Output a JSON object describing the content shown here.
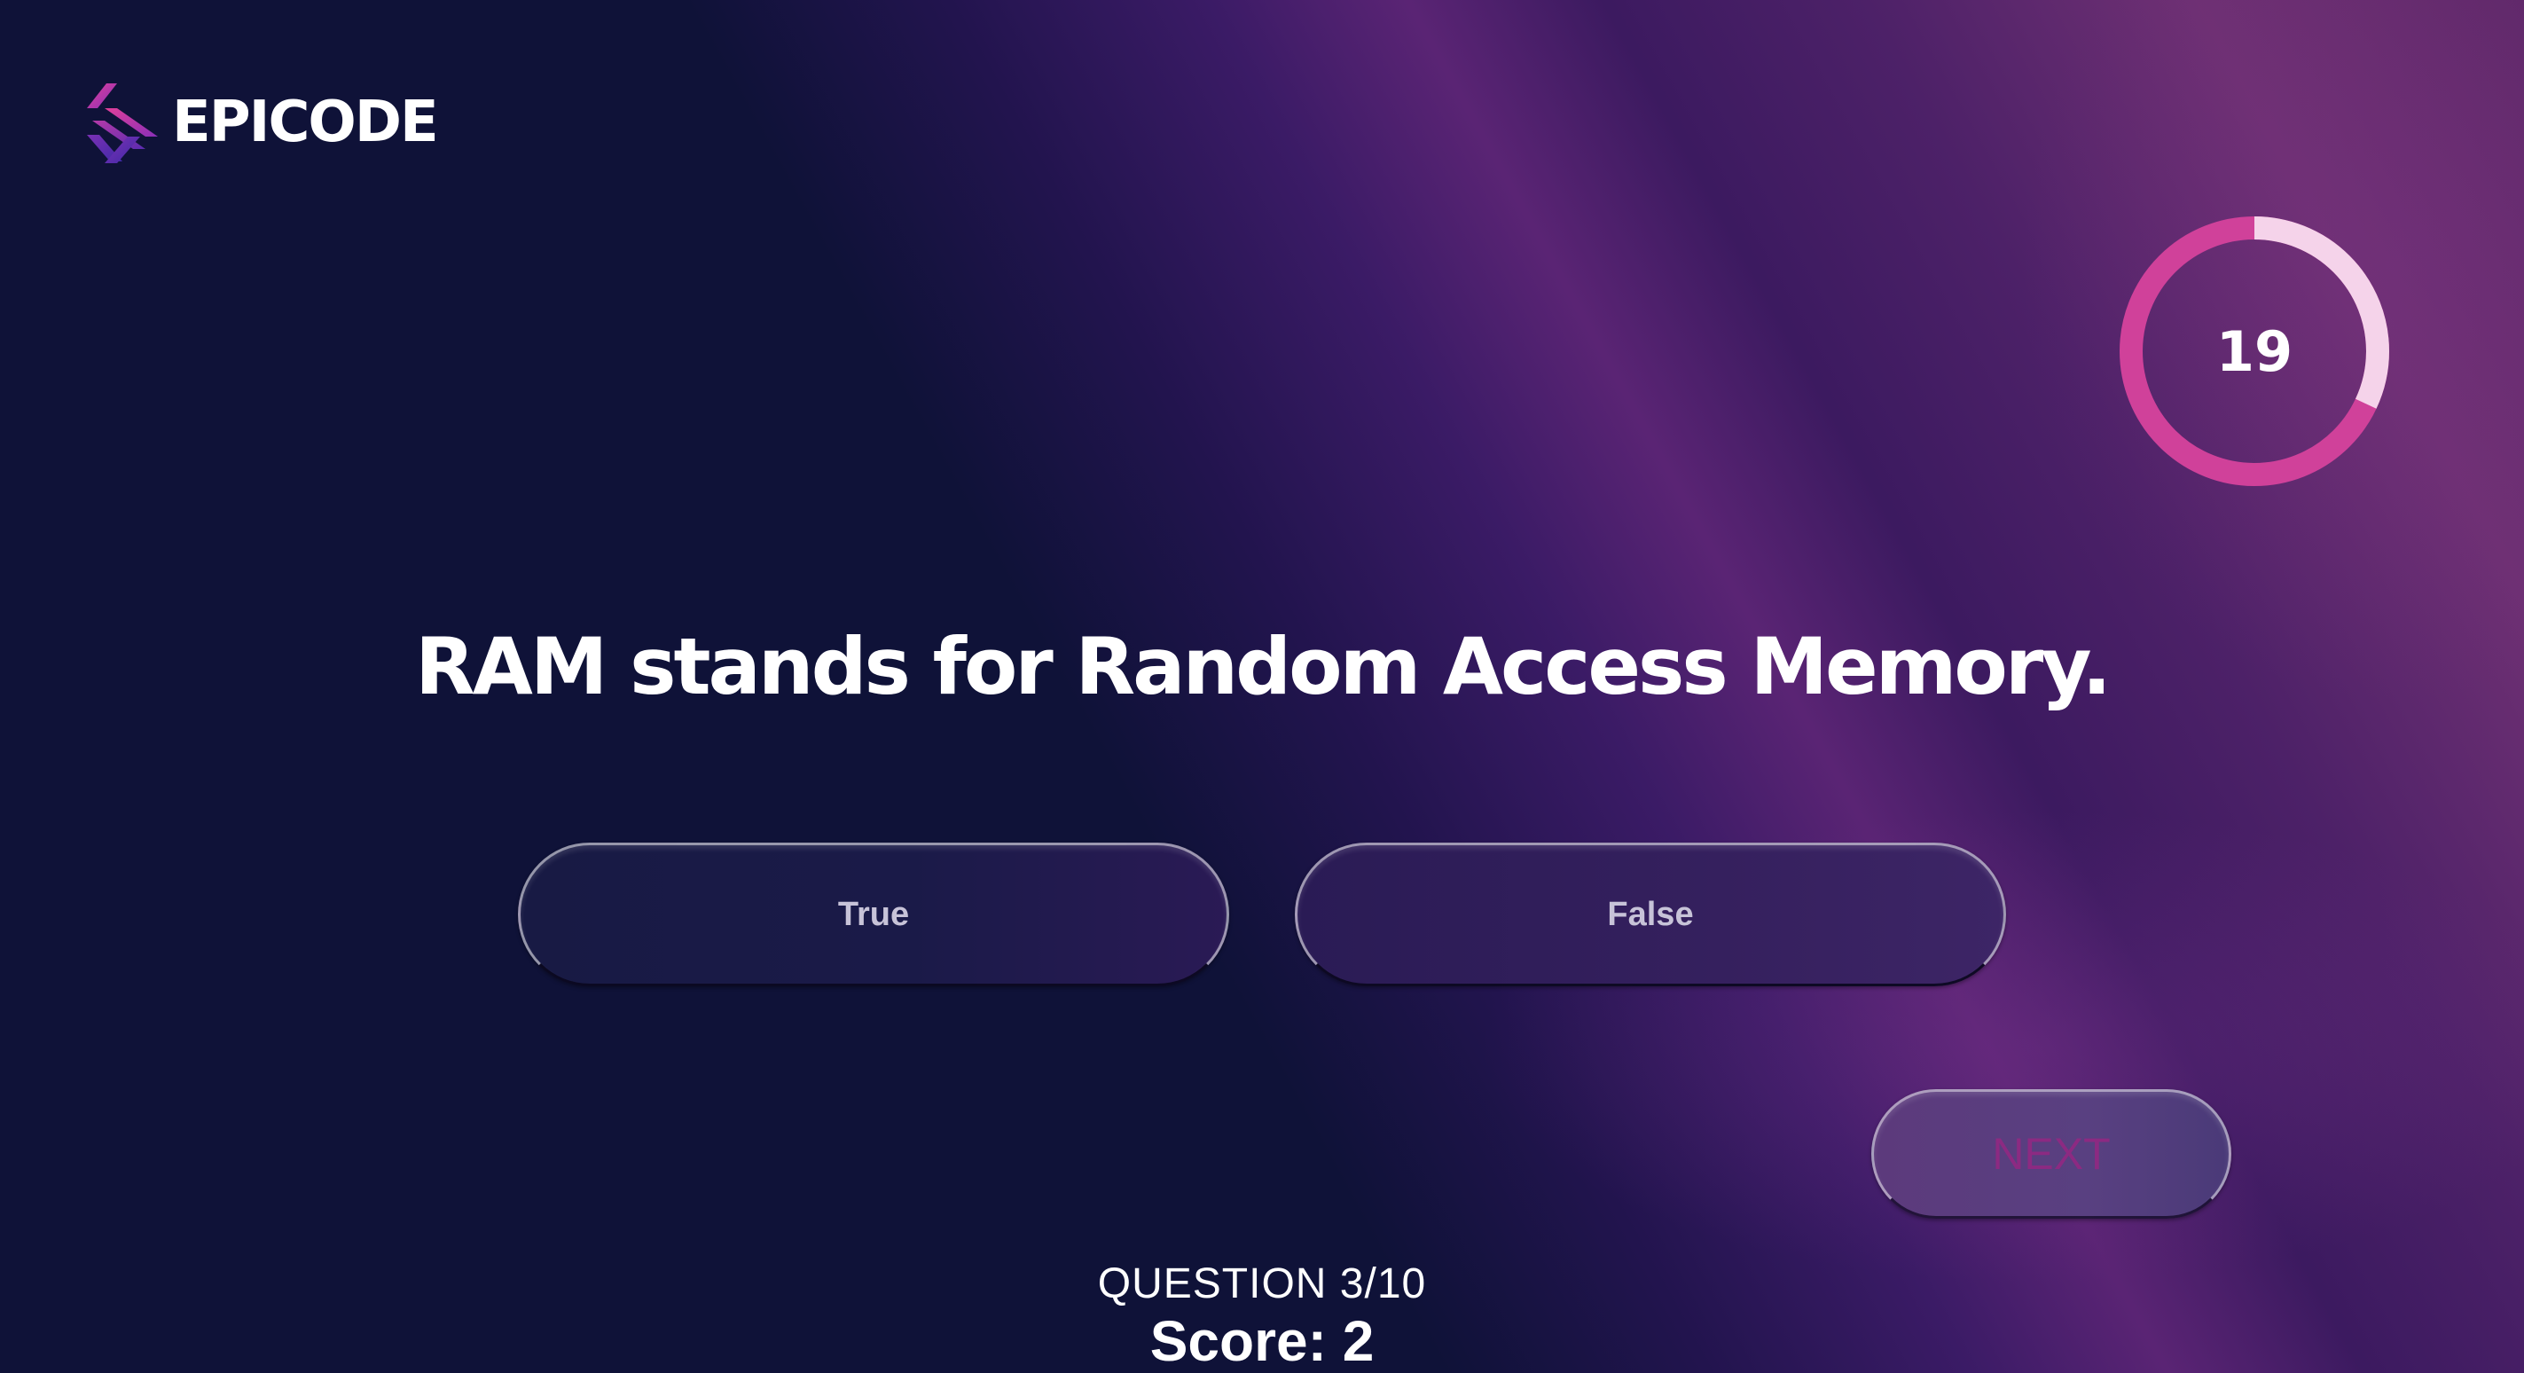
{
  "brand": {
    "name": "EPICODE",
    "icon": "epicode-logo-icon"
  },
  "timer": {
    "value": "19",
    "remaining_fraction": 0.32,
    "track_color": "#f5d3ea",
    "progress_color": "#d0419a"
  },
  "question": {
    "text": "RAM stands for Random Access Memory."
  },
  "answers": [
    {
      "label": "True"
    },
    {
      "label": "False"
    }
  ],
  "next_button": {
    "label": "NEXT"
  },
  "progress": {
    "label": "QUESTION",
    "current": "3",
    "separator": "/",
    "total": "10"
  },
  "score": {
    "label": "Score:",
    "value": "2"
  }
}
